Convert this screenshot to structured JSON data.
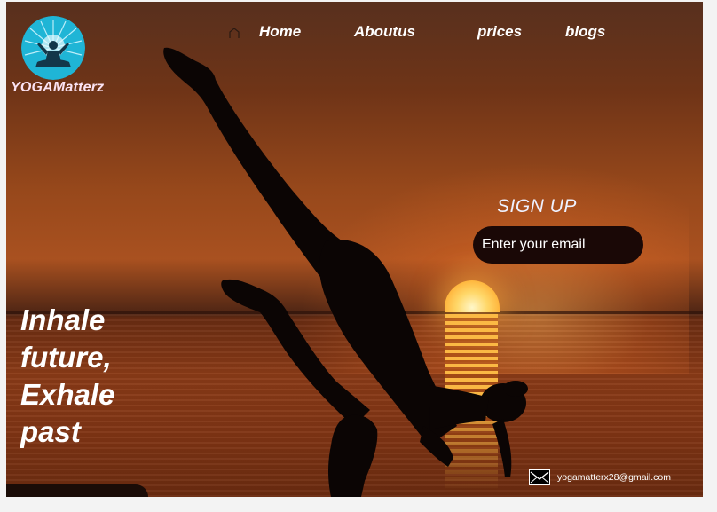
{
  "brand": {
    "name": "YOGAMatterz",
    "logo_icon": "meditation-sunburst-icon"
  },
  "nav": {
    "home_icon": "home-icon",
    "items": [
      {
        "label": "Home"
      },
      {
        "label": "Aboutus"
      },
      {
        "label": "prices"
      },
      {
        "label": "blogs"
      }
    ]
  },
  "signup": {
    "title": "SIGN UP",
    "email_placeholder": "Enter your email",
    "email_value": ""
  },
  "hero": {
    "tagline_lines": [
      "Inhale",
      "future,",
      "Exhale",
      "past"
    ]
  },
  "contact": {
    "icon": "mail-icon",
    "email": "yogamatterx28@gmail.com"
  },
  "colors": {
    "brand_text": "#fbe3f3",
    "logo_bg": "#1fb5d6",
    "input_bg": "#1a0806",
    "sun": "#ffd768"
  }
}
